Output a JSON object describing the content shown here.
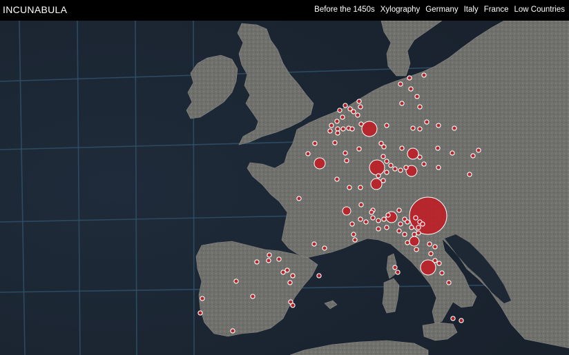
{
  "app": {
    "title": "INCUNABULA"
  },
  "nav": {
    "items": [
      {
        "label": "Before the 1450s",
        "id": "before-1450s"
      },
      {
        "label": "Xylography",
        "id": "xylography"
      },
      {
        "label": "Germany",
        "id": "germany"
      },
      {
        "label": "Italy",
        "id": "italy"
      },
      {
        "label": "France",
        "id": "france"
      },
      {
        "label": "Low Countries",
        "id": "low-countries"
      }
    ]
  },
  "colors": {
    "header_bg": "#000000",
    "sea": "#1c2633",
    "land": "#6e6e6a",
    "graticule": "#2f5168",
    "marker_fill": "#c01d24",
    "marker_stroke": "#ffffff"
  },
  "map": {
    "basemap": "satellite, dark sea",
    "graticule": true,
    "marker_style": "proportional red circles, white outline"
  }
}
